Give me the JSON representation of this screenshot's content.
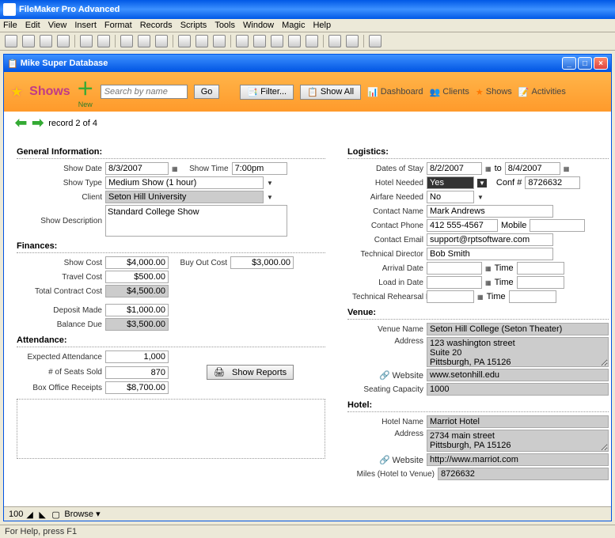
{
  "app": {
    "title": "FileMaker Pro Advanced"
  },
  "menu": [
    "File",
    "Edit",
    "View",
    "Insert",
    "Format",
    "Records",
    "Scripts",
    "Tools",
    "Window",
    "Magic",
    "Help"
  ],
  "window": {
    "title": "Mike Super Database"
  },
  "tab": {
    "title": "Shows",
    "new": "New",
    "search_placeholder": "Search by name",
    "go": "Go",
    "filter": "Filter...",
    "showall": "Show All",
    "dashboard": "Dashboard",
    "clients": "Clients",
    "shows": "Shows",
    "activities": "Activities"
  },
  "recnav": "record 2 of 4",
  "gen": {
    "section": "General Information:",
    "show_date_l": "Show Date",
    "show_date": "8/3/2007",
    "show_time_l": "Show Time",
    "show_time": "7:00pm",
    "show_type_l": "Show Type",
    "show_type": "Medium Show (1 hour)",
    "client_l": "Client",
    "client": "Seton Hill University",
    "desc_l": "Show Description",
    "desc": "Standard College Show"
  },
  "fin": {
    "section": "Finances:",
    "show_cost_l": "Show Cost",
    "show_cost": "$4,000.00",
    "buy_out_l": "Buy Out Cost",
    "buy_out": "$3,000.00",
    "travel_l": "Travel Cost",
    "travel": "$500.00",
    "total_l": "Total Contract Cost",
    "total": "$4,500.00",
    "deposit_l": "Deposit Made",
    "deposit": "$1,000.00",
    "balance_l": "Balance Due",
    "balance": "$3,500.00"
  },
  "att": {
    "section": "Attendance:",
    "exp_l": "Expected Attendance",
    "exp": "1,000",
    "seats_l": "# of Seats Sold",
    "seats": "870",
    "box_l": "Box Office Receipts",
    "box": "$8,700.00",
    "reports": "Show Reports"
  },
  "log": {
    "section": "Logistics:",
    "dates_l": "Dates of Stay",
    "date_from": "8/2/2007",
    "to": "to",
    "date_to": "8/4/2007",
    "hotel_needed_l": "Hotel Needed",
    "hotel_needed": "Yes",
    "conf_l": "Conf #",
    "conf": "8726632",
    "airfare_l": "Airfare Needed",
    "airfare": "No",
    "cname_l": "Contact Name",
    "cname": "Mark Andrews",
    "cphone_l": "Contact Phone",
    "cphone": "412 555-4567",
    "mobile_l": "Mobile",
    "cemail_l": "Contact Email",
    "cemail": "support@rptsoftware.com",
    "tdir_l": "Technical Director",
    "tdir": "Bob Smith",
    "arrival_l": "Arrival Date",
    "time_l": "Time",
    "loadin_l": "Load in Date",
    "reh_l": "Technical Rehearsal Date"
  },
  "venue": {
    "section": "Venue:",
    "name_l": "Venue Name",
    "name": "Seton Hill College (Seton Theater)",
    "addr_l": "Address",
    "addr": "123 washington street\nSuite 20\nPittsburgh, PA 15126",
    "web_l": "Website",
    "web": "www.setonhill.edu",
    "cap_l": "Seating Capacity",
    "cap": "1000"
  },
  "hotel": {
    "section": "Hotel:",
    "name_l": "Hotel Name",
    "name": "Marriot Hotel",
    "addr_l": "Address",
    "addr": "2734 main street\nPittsburgh, PA 15126",
    "web_l": "Website",
    "web": "http://www.marriot.com",
    "miles_l": "Miles (Hotel to Venue)",
    "miles": "8726632"
  },
  "status": {
    "zoom": "100",
    "mode": "Browse"
  },
  "help": "For Help, press F1"
}
